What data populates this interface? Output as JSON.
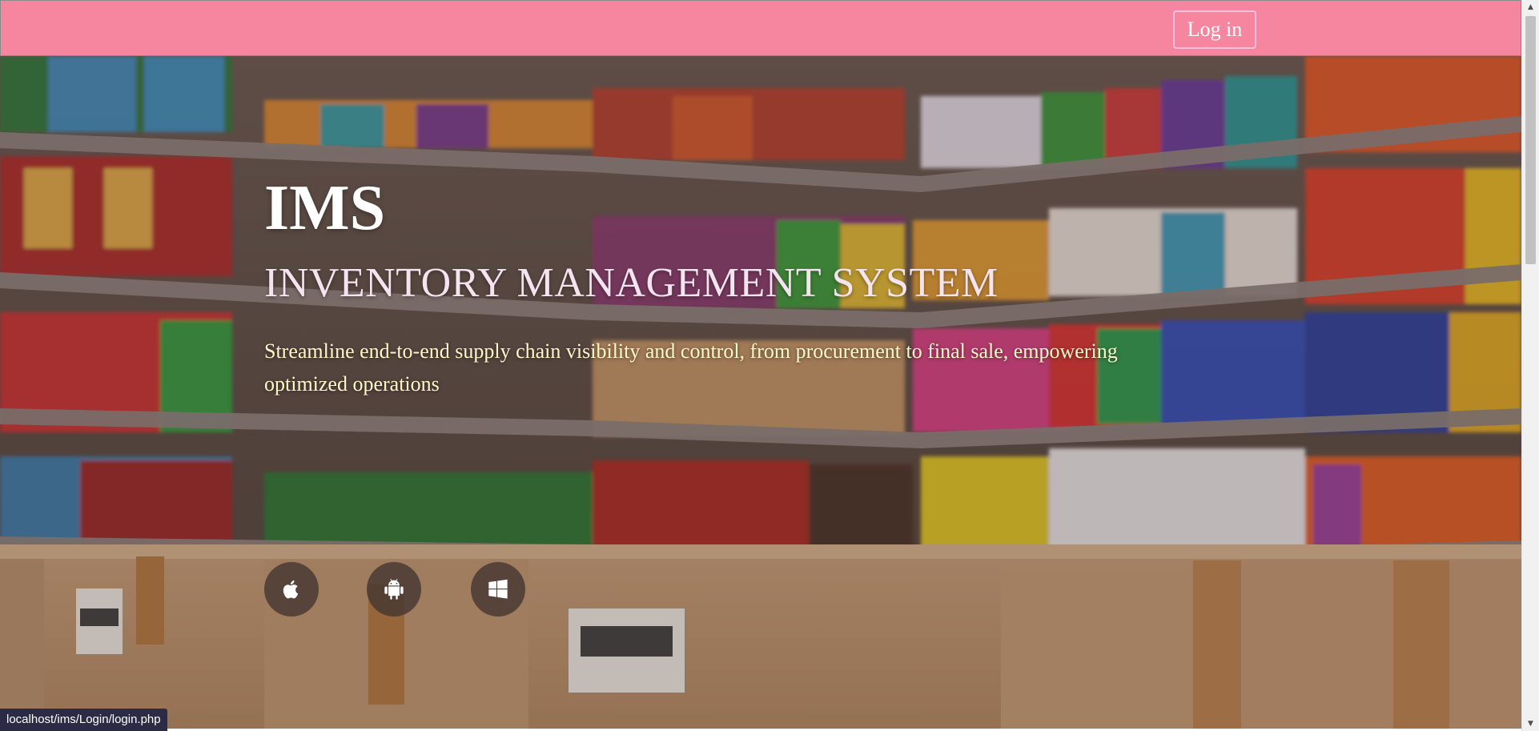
{
  "colors": {
    "navbar_bg": "#f6869f",
    "subtitle": "#f3e4f0",
    "tagline": "#fff8c8",
    "login_border": "#ffc0e0"
  },
  "navbar": {
    "login_label": "Log in"
  },
  "hero": {
    "brand": "IMS",
    "subtitle": "INVENTORY MANAGEMENT SYSTEM",
    "tagline": "Streamline end-to-end supply chain visibility and control, from procurement to final sale, empowering optimized operations",
    "platforms": [
      {
        "icon": "apple-icon"
      },
      {
        "icon": "android-icon"
      },
      {
        "icon": "windows-icon"
      }
    ]
  },
  "status_bar": {
    "url": "localhost/ims/Login/login.php"
  }
}
